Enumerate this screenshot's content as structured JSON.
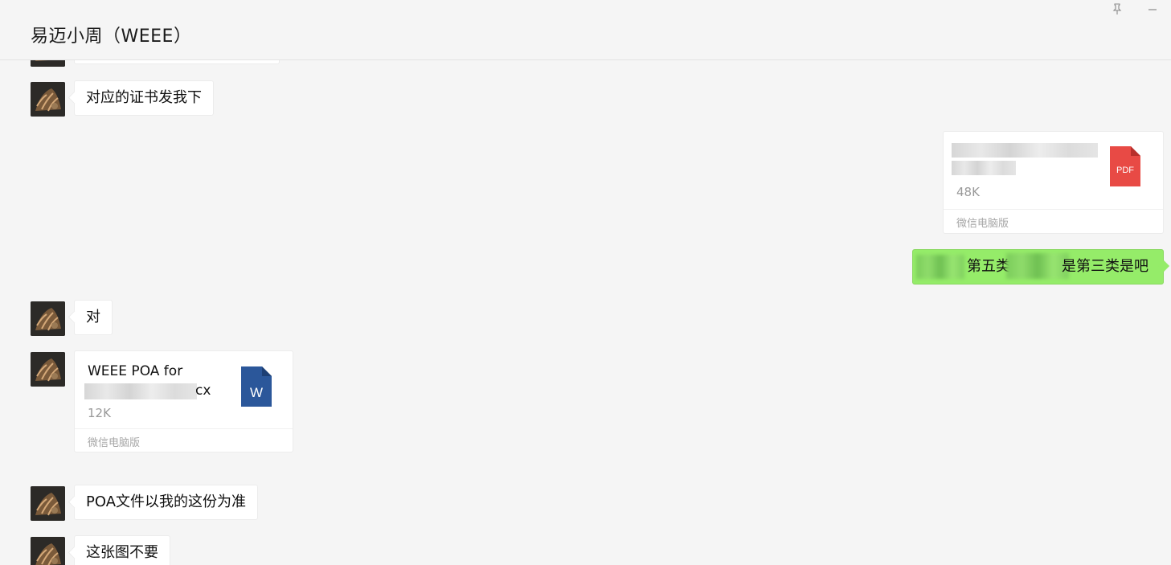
{
  "window": {
    "title": "易迈小周（WEEE）",
    "pin_icon": "pin-icon",
    "minimize_icon": "minimize-icon"
  },
  "messages": [
    {
      "side": "left",
      "type": "text",
      "text": "对应的证书发我下"
    },
    {
      "side": "right",
      "type": "file",
      "file_type": "PDF",
      "size": "48K",
      "source": "微信电脑版"
    },
    {
      "side": "right",
      "type": "text",
      "text_visible_a": "第五类",
      "text_visible_b": "是第三类是吧"
    },
    {
      "side": "left",
      "type": "text",
      "text": "对"
    },
    {
      "side": "left",
      "type": "file",
      "file_type": "W",
      "name_line1": "WEEE POA for",
      "name_line2_suffix": "cx",
      "size": "12K",
      "source": "微信电脑版"
    },
    {
      "side": "left",
      "type": "text",
      "text": "POA文件以我的这份为准"
    },
    {
      "side": "left",
      "type": "text",
      "text": "这张图不要"
    }
  ],
  "colors": {
    "background": "#f5f5f5",
    "bubble_self": "#95ec69",
    "bubble_other": "#ffffff",
    "pdf_icon": "#e84a45",
    "word_icon": "#2b579a"
  }
}
